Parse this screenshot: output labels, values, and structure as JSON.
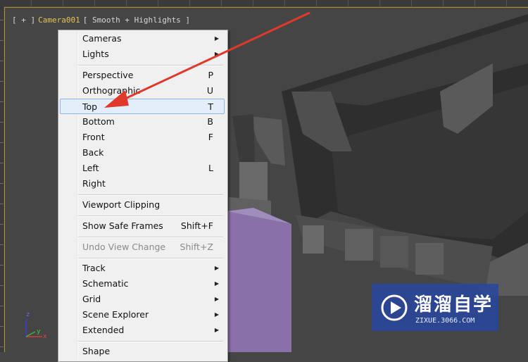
{
  "viewport": {
    "label": {
      "plus": "[ + ]",
      "camera": "Camera001",
      "shading": "[ Smooth + Highlights ]"
    },
    "axis": {
      "x": "x",
      "y": "y",
      "z": "z"
    }
  },
  "context_menu": {
    "items": [
      {
        "label": "Cameras",
        "shortcut": "",
        "submenu": true
      },
      {
        "label": "Lights",
        "shortcut": "",
        "submenu": true
      },
      {
        "label": "Perspective",
        "shortcut": "P"
      },
      {
        "label": "Orthographic",
        "shortcut": "U"
      },
      {
        "label": "Top",
        "shortcut": "T",
        "highlighted": true
      },
      {
        "label": "Bottom",
        "shortcut": "B"
      },
      {
        "label": "Front",
        "shortcut": "F"
      },
      {
        "label": "Back",
        "shortcut": ""
      },
      {
        "label": "Left",
        "shortcut": "L"
      },
      {
        "label": "Right",
        "shortcut": ""
      },
      {
        "label": "Viewport Clipping",
        "shortcut": ""
      },
      {
        "label": "Show Safe Frames",
        "shortcut": "Shift+F"
      },
      {
        "label": "Undo View Change",
        "shortcut": "Shift+Z",
        "disabled": true
      },
      {
        "label": "Track",
        "shortcut": "",
        "submenu": true
      },
      {
        "label": "Schematic",
        "shortcut": "",
        "submenu": true
      },
      {
        "label": "Grid",
        "shortcut": "",
        "submenu": true
      },
      {
        "label": "Scene Explorer",
        "shortcut": "",
        "submenu": true
      },
      {
        "label": "Extended",
        "shortcut": "",
        "submenu": true
      },
      {
        "label": "Shape",
        "shortcut": ""
      }
    ]
  },
  "watermark": {
    "brand": "溜溜自学",
    "url": "ZIXUE.3066.COM"
  },
  "colors": {
    "annotation_arrow": "#e0392b",
    "highlight": "#e3eefa",
    "watermark_bg": "#2c4aa8"
  },
  "icons": [
    "submenu-arrow-icon",
    "play-logo-icon",
    "annotation-arrow-icon",
    "axis-gizmo-icon"
  ]
}
